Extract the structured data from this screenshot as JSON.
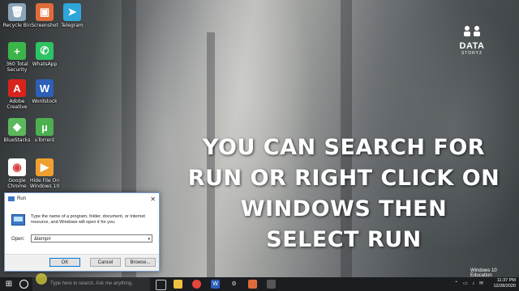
{
  "desktop": {
    "icons": [
      {
        "label": "Recycle Bin",
        "icon": "recycle-bin-icon",
        "color": "#8aa4b8",
        "glyph": "🗑"
      },
      {
        "label": "Screenshot",
        "icon": "screenshot-icon",
        "color": "#e06b3a",
        "glyph": "▣"
      },
      {
        "label": "Telegram",
        "icon": "telegram-icon",
        "color": "#2ea6da",
        "glyph": "➤"
      },
      {
        "label": "360 Total Security",
        "icon": "shield-plus-icon",
        "color": "#3bb54a",
        "glyph": "+"
      },
      {
        "label": "WhatsApp",
        "icon": "whatsapp-icon",
        "color": "#2ec363",
        "glyph": "✆"
      },
      {
        "label": "Adobe Creative",
        "icon": "adobe-icon",
        "color": "#d8241c",
        "glyph": "A"
      },
      {
        "label": "Wordstock",
        "icon": "word-icon",
        "color": "#2b5fb8",
        "glyph": "W"
      },
      {
        "label": "BlueStacks",
        "icon": "bluestacks-icon",
        "color": "#5cb85c",
        "glyph": "◆"
      },
      {
        "label": "uTorrent",
        "icon": "utorrent-icon",
        "color": "#4caf50",
        "glyph": "µ"
      },
      {
        "label": "Google Chrome",
        "icon": "chrome-icon",
        "color": "#ffffff",
        "glyph": "◉"
      },
      {
        "label": "Hide File On Windows 10",
        "icon": "video-file-icon",
        "color": "#f0a030",
        "glyph": "▶"
      }
    ]
  },
  "caption": {
    "line1": "YOU CAN SEARCH FOR",
    "line2": "RUN OR RIGHT CLICK ON",
    "line3": "WINDOWS THEN",
    "line4": "SELECT RUN"
  },
  "logo": {
    "line1": "DATA",
    "line2": "STORYZ"
  },
  "watermark": "Windows 10 Education",
  "run_dialog": {
    "title": "Run",
    "close": "✕",
    "description": "Type the name of a program, folder, document, or Internet resource, and Windows will open it for you.",
    "open_label": "Open:",
    "open_value": "&temp#",
    "ok_label": "OK",
    "cancel_label": "Cancel",
    "browse_label": "Browse..."
  },
  "taskbar": {
    "start_glyph": "⊞",
    "search_placeholder": "Type here to search, Ask me anything.",
    "time": "11:37 PM",
    "date": "12/28/2020",
    "tray_glyphs": "⌃ ▭ ♪ ✉"
  },
  "colors": {
    "accent": "#0078d7",
    "taskbar": "#1b1d20"
  }
}
